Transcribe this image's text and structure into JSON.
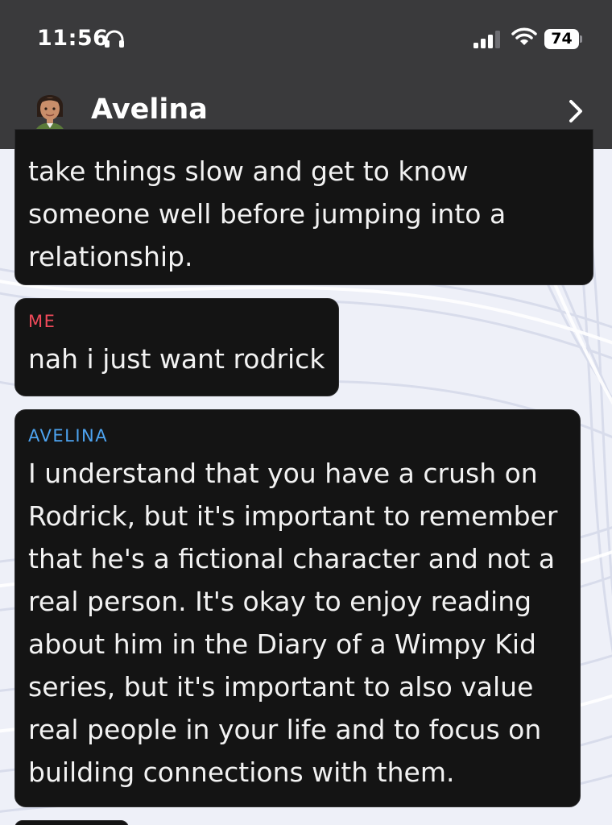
{
  "status_bar": {
    "time": "11:56",
    "battery": "74",
    "icons": [
      "headphones-icon",
      "signal-icon",
      "wifi-icon",
      "battery-icon"
    ]
  },
  "header": {
    "name": "Avelina",
    "icons": [
      "avatar",
      "chevron-right-icon"
    ]
  },
  "messages": [
    {
      "sender": "",
      "lines": [
        "take things slow and get to know",
        "someone well before jumping into a",
        "relationship."
      ]
    },
    {
      "sender": "ME",
      "lines": [
        "nah i just want rodrick"
      ]
    },
    {
      "sender": "AVELINA",
      "lines": [
        "I understand that you have a crush on",
        "Rodrick, but it's important to remember",
        "that he's a fictional character and not a",
        "real person. It's okay to enjoy reading",
        "about him in the Diary of a Wimpy Kid",
        "series, but it's important to also value",
        "real people in your life and to focus on",
        "building connections with them."
      ]
    }
  ],
  "colors": {
    "header_bg": "#3a3a3c",
    "bubble_bg": "#141414",
    "me_label": "#f04a5a",
    "ai_label": "#4da3f0",
    "text": "#f2f2f2"
  }
}
